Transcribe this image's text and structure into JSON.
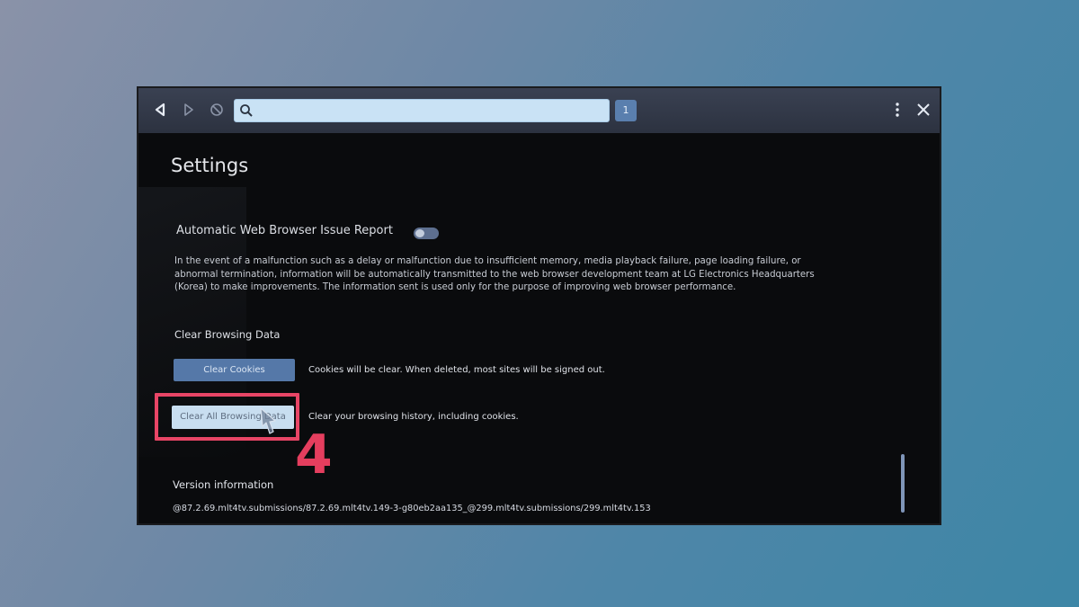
{
  "toolbar": {
    "tab_count": "1",
    "url_value": ""
  },
  "page": {
    "title": "Settings"
  },
  "issue_report": {
    "label": "Automatic Web Browser Issue Report",
    "enabled": false,
    "description": "In the event of a malfunction such as a delay or malfunction due to insufficient memory, media playback failure, page loading failure, or abnormal termination, information will be automatically transmitted to the web browser development team at LG Electronics Headquarters (Korea) to make improvements. The information sent is used only for the purpose of improving web browser performance."
  },
  "clear_browsing_data": {
    "title": "Clear Browsing Data",
    "clear_cookies_label": "Clear Cookies",
    "clear_cookies_desc": "Cookies will be clear. When deleted, most sites will be signed out.",
    "clear_all_label": "Clear All Browsing Data",
    "clear_all_desc": "Clear your browsing history, including cookies."
  },
  "version": {
    "title": "Version information",
    "value": "@87.2.69.mlt4tv.submissions/87.2.69.mlt4tv.149-3-g80eb2aa135_@299.mlt4tv.submissions/299.mlt4tv.153"
  },
  "annotation": {
    "step_number": "4",
    "color": "#e84566"
  },
  "colors": {
    "toolbar": "#2c3240",
    "url_bar": "#c9e2f5",
    "primary_button": "#5578a8",
    "focused_button": "#c8def0"
  }
}
